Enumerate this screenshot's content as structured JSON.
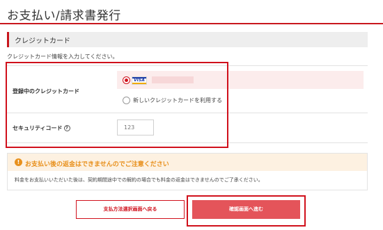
{
  "page": {
    "title": "お支払い/請求書発行"
  },
  "section": {
    "title": "クレジットカード",
    "instruction": "クレジットカード情報を入力してください。"
  },
  "form": {
    "registered_card_label": "登録中のクレジットカード",
    "card_brand": "VISA",
    "registered_card_selected": true,
    "new_card_option": "新しいクレジットカードを利用する",
    "security_code_label": "セキュリティコード",
    "security_code_help": "?",
    "security_code_placeholder": "123"
  },
  "notice": {
    "icon": "!",
    "title": "お支払い後の返金はできませんのでご注意ください",
    "body": "料金をお支払いいただいた後は、契約期間途中での解約の場合でも料金の返金はできませんのでご了承ください。"
  },
  "actions": {
    "back_label": "支払方法選択画面へ戻る",
    "next_label": "確認画面へ進む"
  },
  "colors": {
    "accent": "#c8161d",
    "highlight_outline": "#d0101b",
    "primary_button": "#e4545a",
    "warning": "#e8901c",
    "card_row_bg": "#fcecec"
  }
}
